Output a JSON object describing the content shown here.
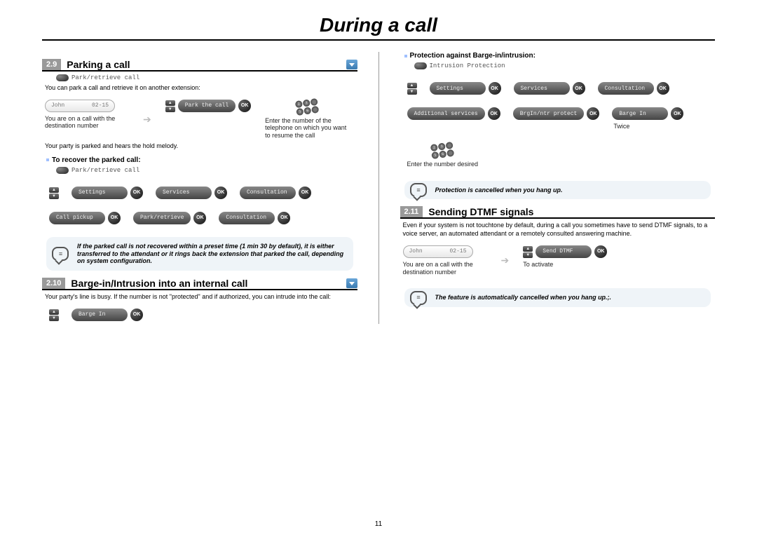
{
  "title": "During a call",
  "page_number": "11",
  "sections": {
    "s29": {
      "num": "2.9",
      "title": "Parking a call",
      "label1": "Park/retrieve call",
      "intro": "You can park a call and retrieve it on another extension:",
      "display_name": "John",
      "display_time": "02-15",
      "action_pill": "Park the call",
      "note_on_call": "You are on a call with the destination number",
      "note_enter": "Enter the number of the telephone on which you want to resume the call",
      "partyline": "Your party is parked and hears the hold melody.",
      "recover_head": "To recover the parked call:",
      "label2": "Park/retrieve call",
      "pills_row1": [
        "Settings",
        "Services",
        "Consultation"
      ],
      "pills_row2": [
        "Call pickup",
        "Park/retrieve",
        "Consultation"
      ],
      "notebox": "If the parked call is not recovered within a preset time (1 min 30 by default), it is either transferred to the attendant or it rings back the extension that parked the call, depending on system configuration."
    },
    "s210": {
      "num": "2.10",
      "title": "Barge-in/Intrusion into an internal call",
      "intro": "Your party's line is busy. If the number is not \"protected\" and if authorized, you can intrude into the call:",
      "pill": "Barge In"
    },
    "protection": {
      "head": "Protection against Barge-in/intrusion:",
      "label": "Intrusion Protection",
      "pills_row1": [
        "Settings",
        "Services",
        "Consultation"
      ],
      "pills_row2": [
        "Additional services",
        "BrgIn/ntr protect",
        "Barge In"
      ],
      "note_twice": "Twice",
      "note_enter": "Enter the number desired",
      "notebox": "Protection is cancelled when you hang up."
    },
    "s211": {
      "num": "2.11",
      "title": "Sending DTMF signals",
      "intro": "Even if your system is not touchtone by default, during a call you sometimes have to send DTMF signals, to a voice server, an automated attendant or a remotely consulted answering machine.",
      "display_name": "John",
      "display_time": "02-15",
      "action_pill": "Send DTMF",
      "note_on_call": "You are on a call with the destination number",
      "note_activate": "To activate",
      "notebox": "The feature is automatically cancelled when you hang up.;."
    }
  }
}
